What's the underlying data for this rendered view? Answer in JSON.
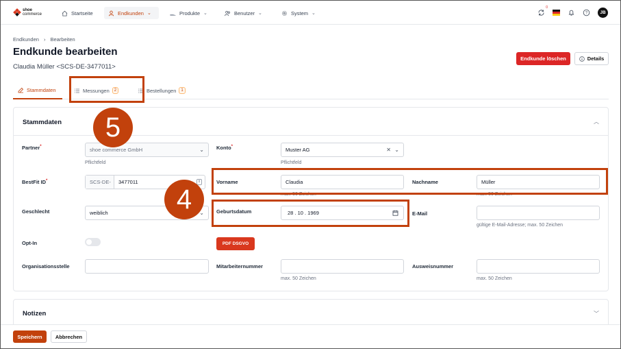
{
  "app": {
    "logo_line1": "shoe",
    "logo_line2": "commerce",
    "accent_color": "#c2410c",
    "danger_color": "#dc2626"
  },
  "nav": {
    "items": [
      {
        "label": "Startseite",
        "icon": "home-icon"
      },
      {
        "label": "Endkunden",
        "icon": "user-icon",
        "active": true
      },
      {
        "label": "Produkte",
        "icon": "shoe-icon"
      },
      {
        "label": "Benutzer",
        "icon": "users-icon"
      },
      {
        "label": "System",
        "icon": "gear-icon"
      }
    ],
    "sync_count": "0",
    "avatar_initials": "JB"
  },
  "breadcrumb": [
    "Endkunden",
    "Bearbeiten"
  ],
  "page": {
    "title": "Endkunde bearbeiten",
    "subtitle": "Claudia Müller <SCS-DE-3477011>",
    "delete_label": "Endkunde löschen",
    "details_label": "Details"
  },
  "tabs": [
    {
      "label": "Stammdaten",
      "icon": "edit-icon",
      "active": true
    },
    {
      "label": "Messungen",
      "icon": "list-icon",
      "count": "2"
    },
    {
      "label": "Bestellungen",
      "icon": "list-icon",
      "count": "1"
    }
  ],
  "stammdaten": {
    "title": "Stammdaten",
    "partner": {
      "label": "Partner",
      "value": "shoe commerce GmbH",
      "hint": "Pflichtfeld"
    },
    "konto": {
      "label": "Konto",
      "value": "Muster AG",
      "hint": "Pflichtfeld"
    },
    "bestfit": {
      "label": "BestFit ID",
      "prefix": "SCS-DE-",
      "value": "3477011"
    },
    "vorname": {
      "label": "Vorname",
      "value": "Claudia",
      "hint": "max. 50 Zeichen"
    },
    "nachname": {
      "label": "Nachname",
      "value": "Müller",
      "hint": "max. 50 Zeichen"
    },
    "geschlecht": {
      "label": "Geschlecht",
      "value": "weiblich"
    },
    "geburtsdatum": {
      "label": "Geburtsdatum",
      "value": "28 . 10 . 1969"
    },
    "email": {
      "label": "E-Mail",
      "value": "",
      "hint": "gültige E-Mail-Adresse; max. 50 Zeichen"
    },
    "optin": {
      "label": "Opt-In",
      "pdf_label": "PDF DSGVO"
    },
    "org": {
      "label": "Organisationsstelle",
      "value": ""
    },
    "mitarbeiter": {
      "label": "Mitarbeiternummer",
      "value": "",
      "hint": "max. 50 Zeichen"
    },
    "ausweis": {
      "label": "Ausweisnummer",
      "value": "",
      "hint": "max. 50 Zeichen"
    }
  },
  "notizen": {
    "title": "Notizen"
  },
  "footer": {
    "save_label": "Speichern",
    "cancel_label": "Abbrechen"
  },
  "annotations": {
    "marker_a": "5",
    "marker_b": "4"
  }
}
